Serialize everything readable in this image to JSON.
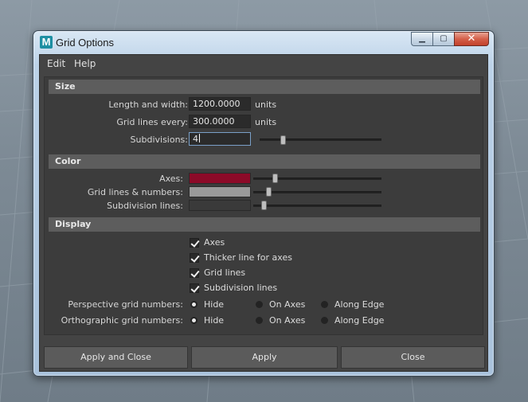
{
  "window": {
    "title": "Grid Options",
    "app_icon_letter": "M",
    "minimize_glyph": "▁",
    "maximize_glyph": "▢",
    "close_glyph": "✕"
  },
  "menu": {
    "items": [
      "Edit",
      "Help"
    ]
  },
  "size": {
    "header": "Size",
    "length_label": "Length and width:",
    "length_value": "1200.0000",
    "length_unit": "units",
    "gridlines_label": "Grid lines every:",
    "gridlines_value": "300.0000",
    "gridlines_unit": "units",
    "subdiv_label": "Subdivisions:",
    "subdiv_value": "4"
  },
  "color": {
    "header": "Color",
    "axes_label": "Axes:",
    "axes_color": "#8c0a28",
    "gridlines_label": "Grid lines & numbers:",
    "gridlines_color": "#9a9a9a",
    "subdiv_label": "Subdivision lines:",
    "subdiv_color": "#3a3a3a"
  },
  "display": {
    "header": "Display",
    "checkboxes": [
      "Axes",
      "Thicker line for axes",
      "Grid lines",
      "Subdivision lines"
    ],
    "perspective_label": "Perspective grid numbers:",
    "ortho_label": "Orthographic grid numbers:",
    "radio_options": [
      "Hide",
      "On Axes",
      "Along Edge"
    ],
    "perspective_selected": "Hide",
    "ortho_selected": "Hide"
  },
  "buttons": {
    "apply_close": "Apply and Close",
    "apply": "Apply",
    "close": "Close"
  }
}
